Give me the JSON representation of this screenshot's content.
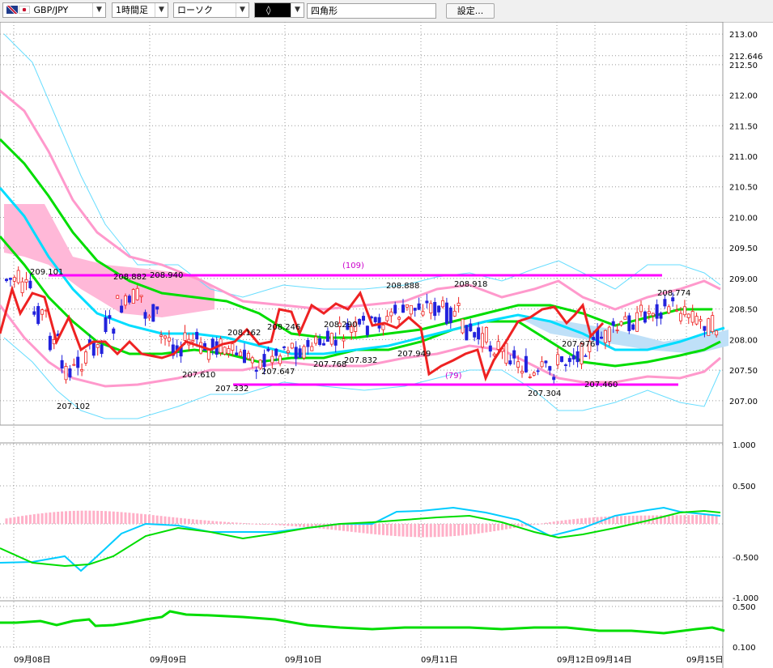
{
  "toolbar": {
    "symbol": "GBP/JPY",
    "timeframe": "1時間足",
    "chart_style": "ローソク",
    "tool": "◊",
    "shape": "四角形",
    "settings_label": "設定..."
  },
  "chart_data": {
    "type": "candlestick",
    "price_ticks": [
      "213.00",
      "212.646",
      "212.50",
      "212.00",
      "211.50",
      "211.00",
      "210.50",
      "210.00",
      "209.50",
      "209.00",
      "208.50",
      "208.00",
      "207.50",
      "207.00"
    ],
    "price_range": [
      206.6,
      213.2
    ],
    "macd_ticks": [
      "1.000",
      "0.500",
      "-0.500",
      "-1.000"
    ],
    "indicator_ticks": [
      "0.500",
      "0.100"
    ],
    "date_labels": [
      "09月08日",
      "09月09日",
      "09月10日",
      "09月11日",
      "09月12日",
      "09月14日",
      "09月15日"
    ],
    "annotations": [
      {
        "text": "209.101",
        "price": 209.1
      },
      {
        "text": "208.882",
        "price": 208.88
      },
      {
        "text": "208.940",
        "price": 208.94
      },
      {
        "text": "208.162",
        "price": 208.16
      },
      {
        "text": "208.246",
        "price": 208.25
      },
      {
        "text": "208.290",
        "price": 208.29
      },
      {
        "text": "208.888",
        "price": 208.89
      },
      {
        "text": "208.918",
        "price": 208.92
      },
      {
        "text": "208.774",
        "price": 208.77
      },
      {
        "text": "207.610",
        "price": 207.61
      },
      {
        "text": "207.332",
        "price": 207.33
      },
      {
        "text": "207.647",
        "price": 207.65
      },
      {
        "text": "207.768",
        "price": 207.77
      },
      {
        "text": "207.832",
        "price": 207.83
      },
      {
        "text": "207.949",
        "price": 207.95
      },
      {
        "text": "207.976",
        "price": 207.98
      },
      {
        "text": "207.102",
        "price": 207.1
      },
      {
        "text": "207.304",
        "price": 207.3
      },
      {
        "text": "207.460",
        "price": 207.46
      }
    ],
    "range_lines": [
      {
        "label": "(109)",
        "price": 209.11
      },
      {
        "label": "(79)",
        "price": 207.38
      }
    ],
    "series": [
      {
        "name": "",
        "color": "#00dd00",
        "values": [
          211.3,
          209.0,
          208.3,
          208.2,
          208.1,
          208.1,
          208.3,
          208.4,
          208.5,
          208.5,
          208.6
        ]
      },
      {
        "name": "",
        "color": "#00ccff",
        "values": [
          210.5,
          208.8,
          208.6,
          208.4,
          208.3,
          208.2,
          208.1,
          208.0,
          208.1,
          208.0,
          208.2
        ]
      },
      {
        "name": "",
        "color": "#ee2222",
        "values": [
          208.3,
          208.5,
          208.0,
          208.6,
          208.7,
          208.3,
          207.8,
          208.4,
          208.5,
          208.4,
          208.4
        ]
      }
    ]
  }
}
